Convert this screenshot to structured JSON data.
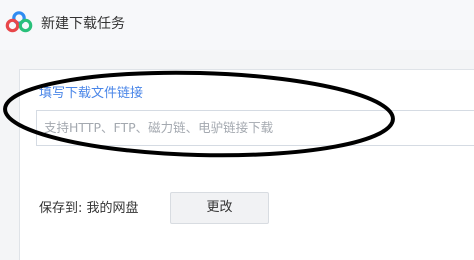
{
  "dialog": {
    "title": "新建下载任务",
    "logo_icon": "baidu-netdisk-cloud-icon",
    "url_field": {
      "label": "填写下载文件链接",
      "value": "",
      "placeholder": "支持HTTP、FTP、磁力链、电驴链接下载"
    },
    "save_location": {
      "label": "保存到: 我的网盘",
      "change_button_label": "更改"
    }
  },
  "colors": {
    "accent_blue": "#4a86e8",
    "logo_blue": "#2f8cf2",
    "logo_red": "#e8474a",
    "logo_green": "#29c07a",
    "annotation_ink": "#000000"
  }
}
